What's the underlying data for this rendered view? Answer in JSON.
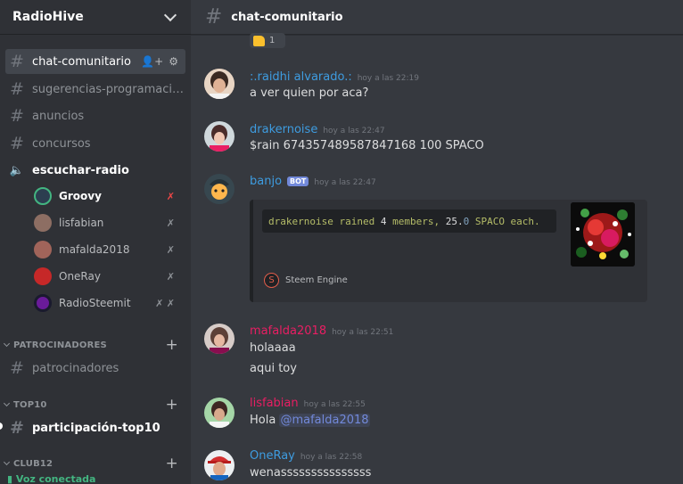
{
  "server": {
    "name": "RadioHive"
  },
  "channels": {
    "chat": "chat-comunitario",
    "sugerencias": "sugerencias-programaci…",
    "anuncios": "anuncios",
    "concursos": "concursos",
    "escuchar": "escuchar-radio"
  },
  "voice_users": [
    {
      "name": "Groovy",
      "icon": "muted-deafened-icon"
    },
    {
      "name": "lisfabian",
      "icon": "muted-icon"
    },
    {
      "name": "mafalda2018",
      "icon": "muted-icon"
    },
    {
      "name": "OneRay",
      "icon": "muted-icon"
    },
    {
      "name": "RadioSteemit",
      "icon": "muted-deafened-icon"
    }
  ],
  "categories": {
    "patrocinadores": "PATROCINADORES",
    "top10": "TOP10",
    "club12": "CLUB12"
  },
  "channels_extra": {
    "patrocinadores": "patrocinadores",
    "participacion": "participación-top10"
  },
  "voice_status": "Voz conectada",
  "header": {
    "channel": "chat-comunitario"
  },
  "reaction": {
    "emoji": "thumbs-up-icon",
    "count": "1"
  },
  "messages": [
    {
      "author": ":.raidhi alvarado.:",
      "color": "#3e9ce0",
      "time": "hoy a las 22:19",
      "lines": [
        "a ver quien por aca?"
      ]
    },
    {
      "author": "drakernoise",
      "color": "#3e9ce0",
      "time": "hoy a las 22:47",
      "lines": [
        "$rain 674357489587847168 100 SPACO"
      ]
    },
    {
      "author": "banjo",
      "color": "#3e9ce0",
      "bot": "BOT",
      "time": "hoy a las 22:47"
    },
    {
      "author": "mafalda2018",
      "color": "#e91e63",
      "time": "hoy a las 22:51",
      "lines": [
        "holaaaa",
        "aqui toy"
      ]
    },
    {
      "author": "lisfabian",
      "color": "#e91e63",
      "time": "hoy a las 22:55",
      "text": "Hola",
      "mention": "@mafalda2018"
    },
    {
      "author": "OneRay",
      "color": "#3e9ce0",
      "time": "hoy a las 22:58",
      "lines": [
        "wenasssssssssssssss"
      ]
    }
  ],
  "embed": {
    "user": "drakernoise",
    "rained": " rained ",
    "count": "4",
    "members": " members, ",
    "amount_int": "25.",
    "amount_dec": "0",
    "coin": " SPACO each.",
    "footer": "Steem Engine"
  },
  "colors": {
    "accent": "#7289da",
    "voice": "#43b581",
    "red": "#f04747"
  }
}
